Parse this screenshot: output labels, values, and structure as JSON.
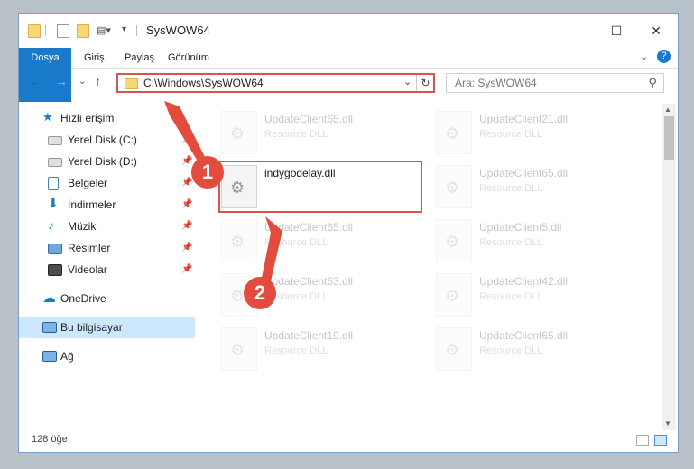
{
  "window": {
    "title": "SysWOW64",
    "minimize_icon": "minimize-icon",
    "maximize_icon": "maximize-icon",
    "close_icon": "close-icon"
  },
  "ribbon": {
    "tabs": [
      "Dosya",
      "Giriş",
      "Paylaş",
      "Görünüm"
    ]
  },
  "nav": {
    "address": "C:\\Windows\\SysWOW64",
    "search_placeholder": "Ara: SysWOW64"
  },
  "sidebar": {
    "items": [
      {
        "label": "Hızlı erişim",
        "icon": "star-icon"
      },
      {
        "label": "Yerel Disk (C:)",
        "icon": "drive-icon"
      },
      {
        "label": "Yerel Disk (D:)",
        "icon": "drive-icon"
      },
      {
        "label": "Belgeler",
        "icon": "documents-icon"
      },
      {
        "label": "İndirmeler",
        "icon": "download-icon"
      },
      {
        "label": "Müzik",
        "icon": "music-icon"
      },
      {
        "label": "Resimler",
        "icon": "pictures-icon"
      },
      {
        "label": "Videolar",
        "icon": "videos-icon"
      },
      {
        "label": "OneDrive",
        "icon": "cloud-icon"
      },
      {
        "label": "Bu bilgisayar",
        "icon": "computer-icon"
      },
      {
        "label": "Ağ",
        "icon": "network-icon"
      }
    ]
  },
  "files": [
    {
      "name": "UpdateClient65.dll",
      "type": "Resource DLL"
    },
    {
      "name": "UpdateClient21.dll",
      "type": "Resource DLL"
    },
    {
      "name": "indygodelay.dll",
      "type": ""
    },
    {
      "name": "UpdateClient65.dll",
      "type": "Resource DLL"
    },
    {
      "name": "UpdateClient65.dll",
      "type": "Resource DLL"
    },
    {
      "name": "UpdateClient5.dll",
      "type": "Resource DLL"
    },
    {
      "name": "UpdateClient63.dll",
      "type": "Resource DLL"
    },
    {
      "name": "UpdateClient42.dll",
      "type": "Resource DLL"
    },
    {
      "name": "UpdateClient19.dll",
      "type": "Resource DLL"
    },
    {
      "name": "UpdateClient65.dll",
      "type": "Resource DLL"
    }
  ],
  "status": {
    "count": "128 öğe"
  },
  "markers": [
    "1",
    "2"
  ],
  "colors": {
    "accent": "#1979ca",
    "highlight": "#d9534f",
    "selected": "#cce8ff"
  }
}
